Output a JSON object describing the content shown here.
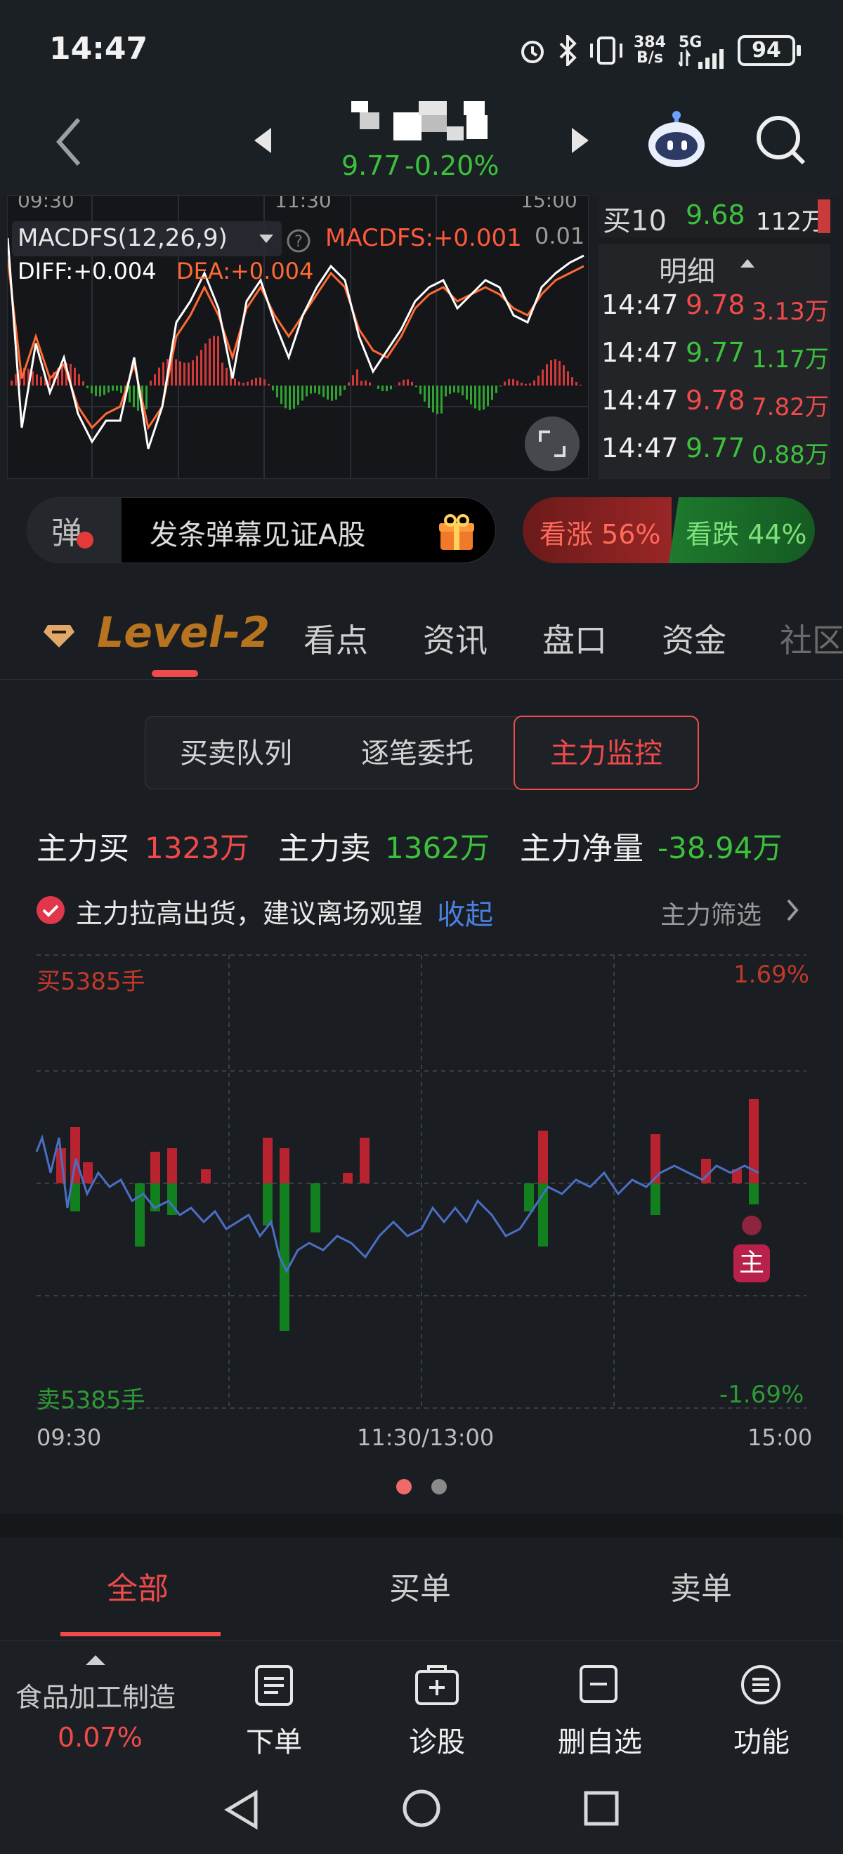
{
  "status_bar": {
    "time": "14:47",
    "net_speed_top": "384",
    "net_speed_bottom": "B/s",
    "signal": "5G",
    "battery": "94"
  },
  "nav": {
    "price": "9.77",
    "change": "-0.20%"
  },
  "macd": {
    "time_left": "09:30",
    "time_mid": "11:30",
    "time_right": "15:00",
    "indicator": "MACDFS(12,26,9)",
    "macd_value": "MACDFS:+0.001",
    "axis_top": "0.01",
    "diff": "DIFF:+0.004",
    "dea": "DEA:+0.004"
  },
  "order_book": {
    "buy10_label": "买10",
    "buy10_price": "9.68",
    "buy10_vol": "112万"
  },
  "detail": {
    "title": "明细",
    "rows": [
      {
        "time": "14:47",
        "price": "9.78",
        "vol": "3.13万",
        "color": "#f04a4a"
      },
      {
        "time": "14:47",
        "price": "9.77",
        "vol": "1.17万",
        "color": "#3cc13c"
      },
      {
        "time": "14:47",
        "price": "9.78",
        "vol": "7.82万",
        "color": "#f04a4a"
      },
      {
        "time": "14:47",
        "price": "9.77",
        "vol": "0.88万",
        "color": "#3cc13c"
      }
    ]
  },
  "danmu": {
    "badge": "弹",
    "placeholder": "发条弹幕见证A股",
    "up": "看涨 56%",
    "down": "看跌 44%"
  },
  "tabs": [
    "Level-2",
    "看点",
    "资讯",
    "盘口",
    "资金",
    "社区"
  ],
  "segments": [
    "买卖队列",
    "逐笔委托",
    "主力监控"
  ],
  "summary": {
    "buy_label": "主力买",
    "buy_value": "1323万",
    "sell_label": "主力卖",
    "sell_value": "1362万",
    "net_label": "主力净量",
    "net_value": "-38.94万"
  },
  "alert": {
    "text": "主力拉高出货，建议离场观望",
    "collapse": "收起",
    "filter": "主力筛选"
  },
  "monitor_chart": {
    "top_left": "买5385手",
    "top_right": "1.69%",
    "bottom_left": "卖5385手",
    "bottom_right": "-1.69%",
    "x_left": "09:30",
    "x_mid": "11:30/13:00",
    "x_right": "15:00",
    "marker": "主"
  },
  "bottom_tabs": [
    "全部",
    "买单",
    "卖单"
  ],
  "toolbar": {
    "sector": "食品加工制造",
    "sector_change": "0.07%",
    "items": [
      "下单",
      "诊股",
      "删自选",
      "功能"
    ]
  },
  "colors": {
    "red": "#f04a4a",
    "green": "#3cc13c",
    "accent_orange": "#b8731f",
    "line_blue": "#4a6fc4"
  }
}
